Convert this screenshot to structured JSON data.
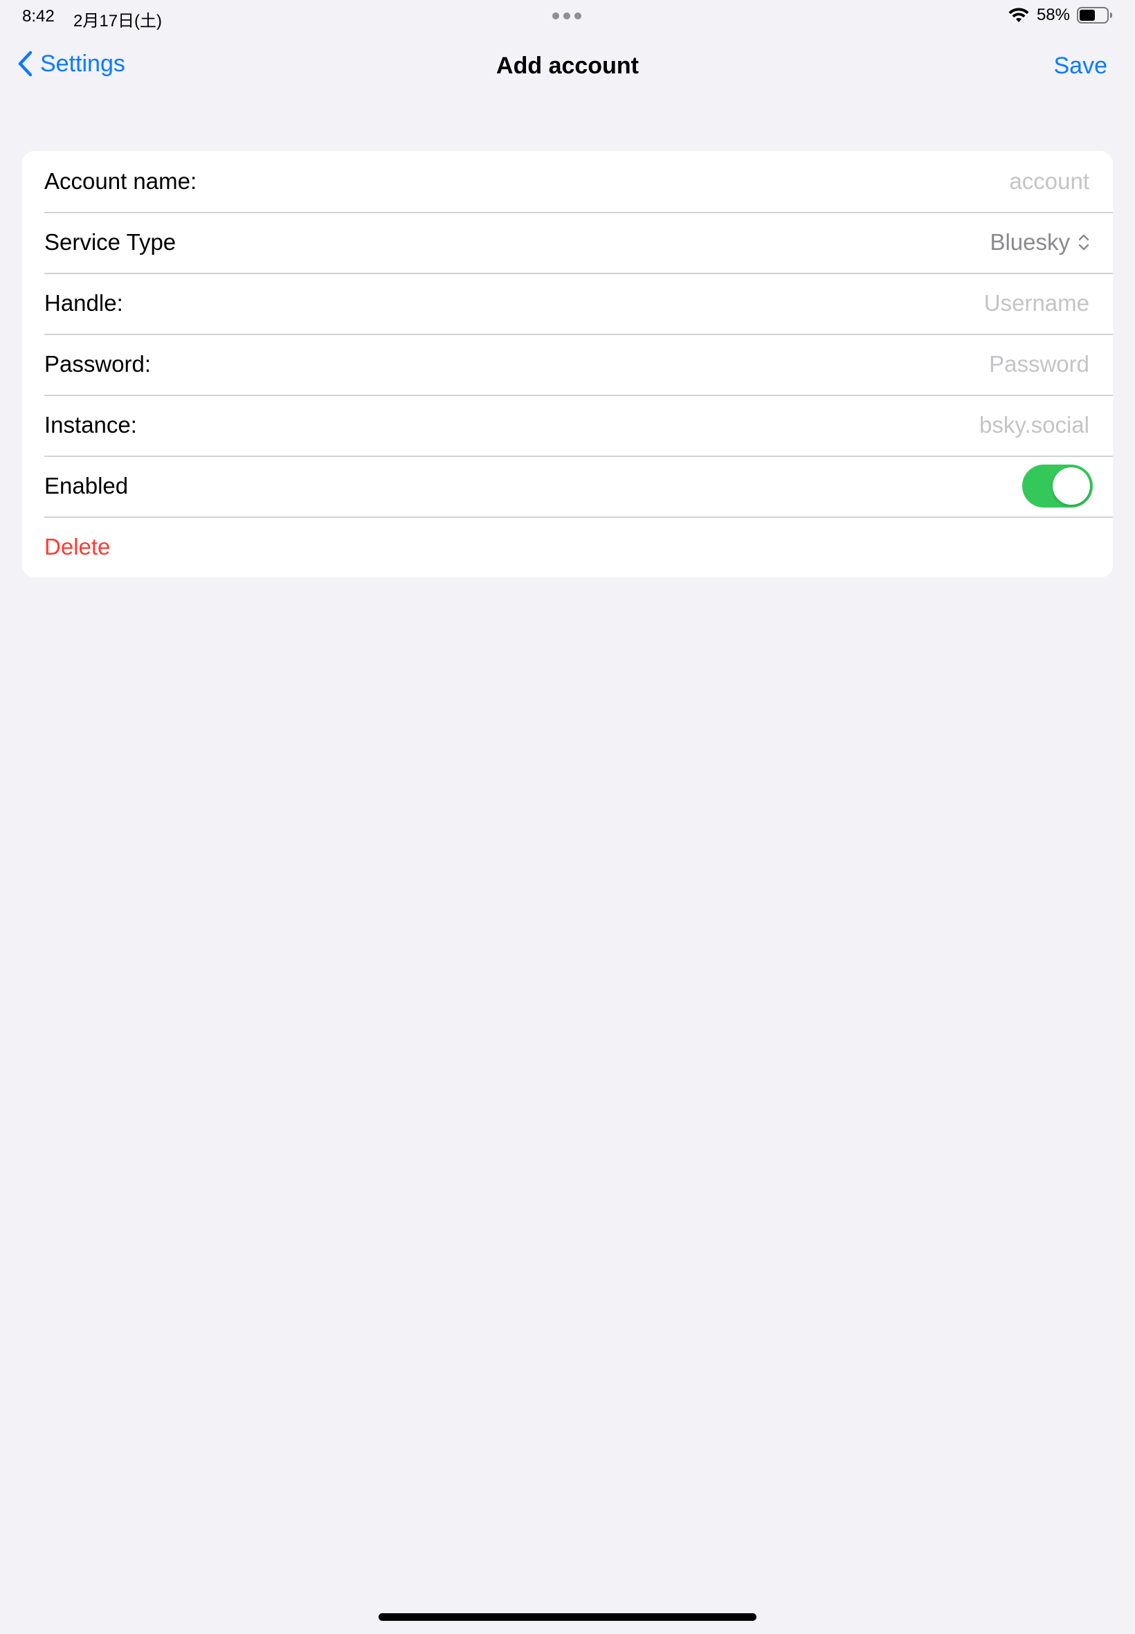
{
  "status_bar": {
    "time": "8:42",
    "date": "2月17日(土)",
    "battery_percent": "58%",
    "battery_level": 0.58,
    "icons": [
      "wifi-icon",
      "battery-icon"
    ]
  },
  "nav": {
    "back_label": "Settings",
    "title": "Add account",
    "save_label": "Save",
    "accent_color": "#0a7aff"
  },
  "form": {
    "account_name": {
      "label": "Account name:",
      "value": "",
      "placeholder": "account"
    },
    "service_type": {
      "label": "Service Type",
      "value": "Bluesky"
    },
    "handle": {
      "label": "Handle:",
      "value": "",
      "placeholder": "Username"
    },
    "password": {
      "label": "Password:",
      "value": "",
      "placeholder": "Password"
    },
    "instance": {
      "label": "Instance:",
      "value": "",
      "placeholder": "bsky.social"
    },
    "enabled": {
      "label": "Enabled",
      "on": true,
      "color": "#34c759"
    },
    "delete": {
      "label": "Delete",
      "color": "#ff3b30"
    }
  }
}
